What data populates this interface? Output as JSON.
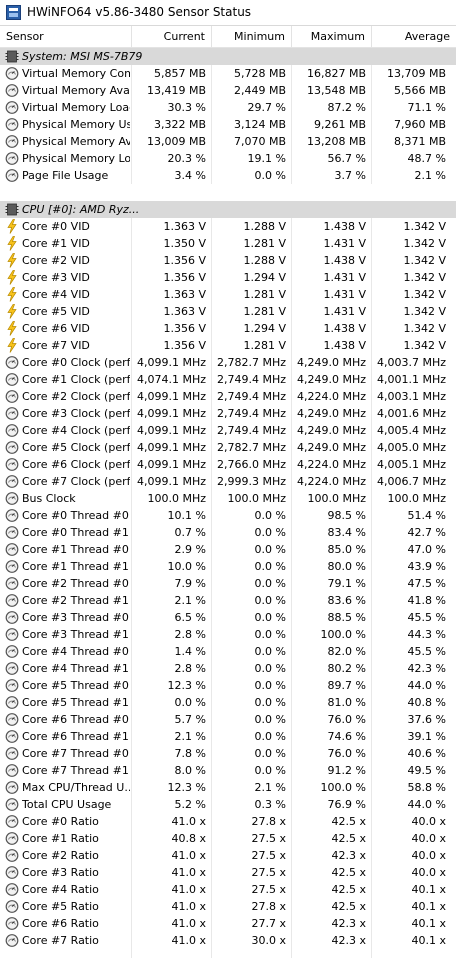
{
  "window": {
    "title": "HWiNFO64 v5.86-3480 Sensor Status"
  },
  "columns": {
    "sensor": "Sensor",
    "current": "Current",
    "minimum": "Minimum",
    "maximum": "Maximum",
    "average": "Average"
  },
  "rows": [
    {
      "type": "group",
      "name": "System: MSI MS-7B79",
      "icon": "chip-icon"
    },
    {
      "type": "sensor",
      "icon": "gauge-icon",
      "name": "Virtual Memory Com...",
      "cur": "5,857 MB",
      "min": "5,728 MB",
      "max": "16,827 MB",
      "avg": "13,709 MB"
    },
    {
      "type": "sensor",
      "icon": "gauge-icon",
      "name": "Virtual Memory Avai...",
      "cur": "13,419 MB",
      "min": "2,449 MB",
      "max": "13,548 MB",
      "avg": "5,566 MB"
    },
    {
      "type": "sensor",
      "icon": "gauge-icon",
      "name": "Virtual Memory Load",
      "cur": "30.3 %",
      "min": "29.7 %",
      "max": "87.2 %",
      "avg": "71.1 %"
    },
    {
      "type": "sensor",
      "icon": "gauge-icon",
      "name": "Physical Memory Used",
      "cur": "3,322 MB",
      "min": "3,124 MB",
      "max": "9,261 MB",
      "avg": "7,960 MB"
    },
    {
      "type": "sensor",
      "icon": "gauge-icon",
      "name": "Physical Memory Av...",
      "cur": "13,009 MB",
      "min": "7,070 MB",
      "max": "13,208 MB",
      "avg": "8,371 MB"
    },
    {
      "type": "sensor",
      "icon": "gauge-icon",
      "name": "Physical Memory Load",
      "cur": "20.3 %",
      "min": "19.1 %",
      "max": "56.7 %",
      "avg": "48.7 %"
    },
    {
      "type": "sensor",
      "icon": "gauge-icon",
      "name": "Page File Usage",
      "cur": "3.4 %",
      "min": "0.0 %",
      "max": "3.7 %",
      "avg": "2.1 %"
    },
    {
      "type": "blank"
    },
    {
      "type": "group",
      "name": "CPU [#0]: AMD Ryz...",
      "icon": "chip-icon"
    },
    {
      "type": "sensor",
      "icon": "lightning-icon",
      "name": "Core #0 VID",
      "cur": "1.363 V",
      "min": "1.288 V",
      "max": "1.438 V",
      "avg": "1.342 V"
    },
    {
      "type": "sensor",
      "icon": "lightning-icon",
      "name": "Core #1 VID",
      "cur": "1.350 V",
      "min": "1.281 V",
      "max": "1.431 V",
      "avg": "1.342 V"
    },
    {
      "type": "sensor",
      "icon": "lightning-icon",
      "name": "Core #2 VID",
      "cur": "1.356 V",
      "min": "1.288 V",
      "max": "1.438 V",
      "avg": "1.342 V"
    },
    {
      "type": "sensor",
      "icon": "lightning-icon",
      "name": "Core #3 VID",
      "cur": "1.356 V",
      "min": "1.294 V",
      "max": "1.431 V",
      "avg": "1.342 V"
    },
    {
      "type": "sensor",
      "icon": "lightning-icon",
      "name": "Core #4 VID",
      "cur": "1.363 V",
      "min": "1.281 V",
      "max": "1.431 V",
      "avg": "1.342 V"
    },
    {
      "type": "sensor",
      "icon": "lightning-icon",
      "name": "Core #5 VID",
      "cur": "1.363 V",
      "min": "1.281 V",
      "max": "1.431 V",
      "avg": "1.342 V"
    },
    {
      "type": "sensor",
      "icon": "lightning-icon",
      "name": "Core #6 VID",
      "cur": "1.356 V",
      "min": "1.294 V",
      "max": "1.438 V",
      "avg": "1.342 V"
    },
    {
      "type": "sensor",
      "icon": "lightning-icon",
      "name": "Core #7 VID",
      "cur": "1.356 V",
      "min": "1.281 V",
      "max": "1.438 V",
      "avg": "1.342 V"
    },
    {
      "type": "sensor",
      "icon": "gauge-icon",
      "name": "Core #0 Clock (perf...",
      "cur": "4,099.1 MHz",
      "min": "2,782.7 MHz",
      "max": "4,249.0 MHz",
      "avg": "4,003.7 MHz"
    },
    {
      "type": "sensor",
      "icon": "gauge-icon",
      "name": "Core #1 Clock (perf...",
      "cur": "4,074.1 MHz",
      "min": "2,749.4 MHz",
      "max": "4,249.0 MHz",
      "avg": "4,001.1 MHz"
    },
    {
      "type": "sensor",
      "icon": "gauge-icon",
      "name": "Core #2 Clock (perf...",
      "cur": "4,099.1 MHz",
      "min": "2,749.4 MHz",
      "max": "4,224.0 MHz",
      "avg": "4,003.1 MHz"
    },
    {
      "type": "sensor",
      "icon": "gauge-icon",
      "name": "Core #3 Clock (perf...",
      "cur": "4,099.1 MHz",
      "min": "2,749.4 MHz",
      "max": "4,249.0 MHz",
      "avg": "4,001.6 MHz"
    },
    {
      "type": "sensor",
      "icon": "gauge-icon",
      "name": "Core #4 Clock (perf...",
      "cur": "4,099.1 MHz",
      "min": "2,749.4 MHz",
      "max": "4,249.0 MHz",
      "avg": "4,005.4 MHz"
    },
    {
      "type": "sensor",
      "icon": "gauge-icon",
      "name": "Core #5 Clock (perf...",
      "cur": "4,099.1 MHz",
      "min": "2,782.7 MHz",
      "max": "4,249.0 MHz",
      "avg": "4,005.0 MHz"
    },
    {
      "type": "sensor",
      "icon": "gauge-icon",
      "name": "Core #6 Clock (perf...",
      "cur": "4,099.1 MHz",
      "min": "2,766.0 MHz",
      "max": "4,224.0 MHz",
      "avg": "4,005.1 MHz"
    },
    {
      "type": "sensor",
      "icon": "gauge-icon",
      "name": "Core #7 Clock (perf...",
      "cur": "4,099.1 MHz",
      "min": "2,999.3 MHz",
      "max": "4,224.0 MHz",
      "avg": "4,006.7 MHz"
    },
    {
      "type": "sensor",
      "icon": "gauge-icon",
      "name": "Bus Clock",
      "cur": "100.0 MHz",
      "min": "100.0 MHz",
      "max": "100.0 MHz",
      "avg": "100.0 MHz"
    },
    {
      "type": "sensor",
      "icon": "gauge-icon",
      "name": "Core #0 Thread #0...",
      "cur": "10.1 %",
      "min": "0.0 %",
      "max": "98.5 %",
      "avg": "51.4 %"
    },
    {
      "type": "sensor",
      "icon": "gauge-icon",
      "name": "Core #0 Thread #1...",
      "cur": "0.7 %",
      "min": "0.0 %",
      "max": "83.4 %",
      "avg": "42.7 %"
    },
    {
      "type": "sensor",
      "icon": "gauge-icon",
      "name": "Core #1 Thread #0...",
      "cur": "2.9 %",
      "min": "0.0 %",
      "max": "85.0 %",
      "avg": "47.0 %"
    },
    {
      "type": "sensor",
      "icon": "gauge-icon",
      "name": "Core #1 Thread #1...",
      "cur": "10.0 %",
      "min": "0.0 %",
      "max": "80.0 %",
      "avg": "43.9 %"
    },
    {
      "type": "sensor",
      "icon": "gauge-icon",
      "name": "Core #2 Thread #0...",
      "cur": "7.9 %",
      "min": "0.0 %",
      "max": "79.1 %",
      "avg": "47.5 %"
    },
    {
      "type": "sensor",
      "icon": "gauge-icon",
      "name": "Core #2 Thread #1...",
      "cur": "2.1 %",
      "min": "0.0 %",
      "max": "83.6 %",
      "avg": "41.8 %"
    },
    {
      "type": "sensor",
      "icon": "gauge-icon",
      "name": "Core #3 Thread #0...",
      "cur": "6.5 %",
      "min": "0.0 %",
      "max": "88.5 %",
      "avg": "45.5 %"
    },
    {
      "type": "sensor",
      "icon": "gauge-icon",
      "name": "Core #3 Thread #1...",
      "cur": "2.8 %",
      "min": "0.0 %",
      "max": "100.0 %",
      "avg": "44.3 %"
    },
    {
      "type": "sensor",
      "icon": "gauge-icon",
      "name": "Core #4 Thread #0...",
      "cur": "1.4 %",
      "min": "0.0 %",
      "max": "82.0 %",
      "avg": "45.5 %"
    },
    {
      "type": "sensor",
      "icon": "gauge-icon",
      "name": "Core #4 Thread #1...",
      "cur": "2.8 %",
      "min": "0.0 %",
      "max": "80.2 %",
      "avg": "42.3 %"
    },
    {
      "type": "sensor",
      "icon": "gauge-icon",
      "name": "Core #5 Thread #0...",
      "cur": "12.3 %",
      "min": "0.0 %",
      "max": "89.7 %",
      "avg": "44.0 %"
    },
    {
      "type": "sensor",
      "icon": "gauge-icon",
      "name": "Core #5 Thread #1...",
      "cur": "0.0 %",
      "min": "0.0 %",
      "max": "81.0 %",
      "avg": "40.8 %"
    },
    {
      "type": "sensor",
      "icon": "gauge-icon",
      "name": "Core #6 Thread #0...",
      "cur": "5.7 %",
      "min": "0.0 %",
      "max": "76.0 %",
      "avg": "37.6 %"
    },
    {
      "type": "sensor",
      "icon": "gauge-icon",
      "name": "Core #6 Thread #1...",
      "cur": "2.1 %",
      "min": "0.0 %",
      "max": "74.6 %",
      "avg": "39.1 %"
    },
    {
      "type": "sensor",
      "icon": "gauge-icon",
      "name": "Core #7 Thread #0...",
      "cur": "7.8 %",
      "min": "0.0 %",
      "max": "76.0 %",
      "avg": "40.6 %"
    },
    {
      "type": "sensor",
      "icon": "gauge-icon",
      "name": "Core #7 Thread #1...",
      "cur": "8.0 %",
      "min": "0.0 %",
      "max": "91.2 %",
      "avg": "49.5 %"
    },
    {
      "type": "sensor",
      "icon": "gauge-icon",
      "name": "Max CPU/Thread U...",
      "cur": "12.3 %",
      "min": "2.1 %",
      "max": "100.0 %",
      "avg": "58.8 %"
    },
    {
      "type": "sensor",
      "icon": "gauge-icon",
      "name": "Total CPU Usage",
      "cur": "5.2 %",
      "min": "0.3 %",
      "max": "76.9 %",
      "avg": "44.0 %"
    },
    {
      "type": "sensor",
      "icon": "gauge-icon",
      "name": "Core #0 Ratio",
      "cur": "41.0 x",
      "min": "27.8 x",
      "max": "42.5 x",
      "avg": "40.0 x"
    },
    {
      "type": "sensor",
      "icon": "gauge-icon",
      "name": "Core #1 Ratio",
      "cur": "40.8 x",
      "min": "27.5 x",
      "max": "42.5 x",
      "avg": "40.0 x"
    },
    {
      "type": "sensor",
      "icon": "gauge-icon",
      "name": "Core #2 Ratio",
      "cur": "41.0 x",
      "min": "27.5 x",
      "max": "42.3 x",
      "avg": "40.0 x"
    },
    {
      "type": "sensor",
      "icon": "gauge-icon",
      "name": "Core #3 Ratio",
      "cur": "41.0 x",
      "min": "27.5 x",
      "max": "42.5 x",
      "avg": "40.0 x"
    },
    {
      "type": "sensor",
      "icon": "gauge-icon",
      "name": "Core #4 Ratio",
      "cur": "41.0 x",
      "min": "27.5 x",
      "max": "42.5 x",
      "avg": "40.1 x"
    },
    {
      "type": "sensor",
      "icon": "gauge-icon",
      "name": "Core #5 Ratio",
      "cur": "41.0 x",
      "min": "27.8 x",
      "max": "42.5 x",
      "avg": "40.1 x"
    },
    {
      "type": "sensor",
      "icon": "gauge-icon",
      "name": "Core #6 Ratio",
      "cur": "41.0 x",
      "min": "27.7 x",
      "max": "42.3 x",
      "avg": "40.1 x"
    },
    {
      "type": "sensor",
      "icon": "gauge-icon",
      "name": "Core #7 Ratio",
      "cur": "41.0 x",
      "min": "30.0 x",
      "max": "42.3 x",
      "avg": "40.1 x"
    }
  ]
}
